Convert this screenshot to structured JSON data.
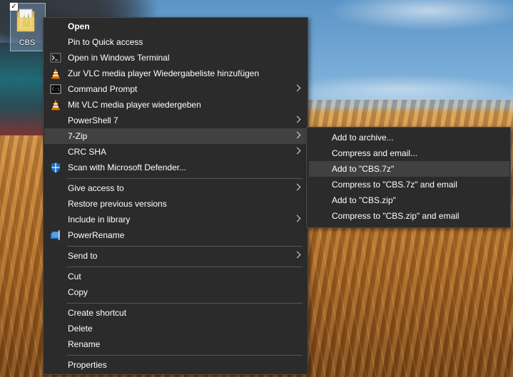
{
  "desktop": {
    "icon_label": "CBS",
    "checkbox_mark": "✓"
  },
  "menu": {
    "items": [
      {
        "label": "Open",
        "bold": true
      },
      {
        "label": "Pin to Quick access"
      },
      {
        "label": "Open in Windows Terminal",
        "icon": "terminal-icon"
      },
      {
        "label": "Zur VLC media player Wiedergabeliste hinzufügen",
        "icon": "vlc-icon"
      },
      {
        "label": "Command Prompt",
        "icon": "cmd-icon",
        "submenu": true
      },
      {
        "label": "Mit VLC media player wiedergeben",
        "icon": "vlc-icon"
      },
      {
        "label": "PowerShell 7",
        "icon": "powershell-icon",
        "submenu": true
      },
      {
        "label": "7-Zip",
        "submenu": true,
        "highlighted": true
      },
      {
        "label": "CRC SHA",
        "submenu": true
      },
      {
        "label": "Scan with Microsoft Defender...",
        "icon": "defender-shield-icon"
      },
      {
        "label": "Give access to",
        "submenu": true
      },
      {
        "label": "Restore previous versions"
      },
      {
        "label": "Include in library",
        "submenu": true
      },
      {
        "label": "PowerRename",
        "icon": "powerrename-icon"
      },
      {
        "label": "Send to",
        "submenu": true
      },
      {
        "label": "Cut"
      },
      {
        "label": "Copy"
      },
      {
        "label": "Create shortcut"
      },
      {
        "label": "Delete"
      },
      {
        "label": "Rename"
      },
      {
        "label": "Properties"
      }
    ]
  },
  "submenu_7zip": {
    "items": [
      {
        "label": "Add to archive..."
      },
      {
        "label": "Compress and email..."
      },
      {
        "label": "Add to \"CBS.7z\"",
        "highlighted": true
      },
      {
        "label": "Compress to \"CBS.7z\" and email"
      },
      {
        "label": "Add to \"CBS.zip\""
      },
      {
        "label": "Compress to \"CBS.zip\" and email"
      }
    ]
  },
  "colors": {
    "menu_bg": "#2b2b2b",
    "hover_bg": "#414141",
    "separator": "#555555",
    "text": "#ffffff"
  }
}
